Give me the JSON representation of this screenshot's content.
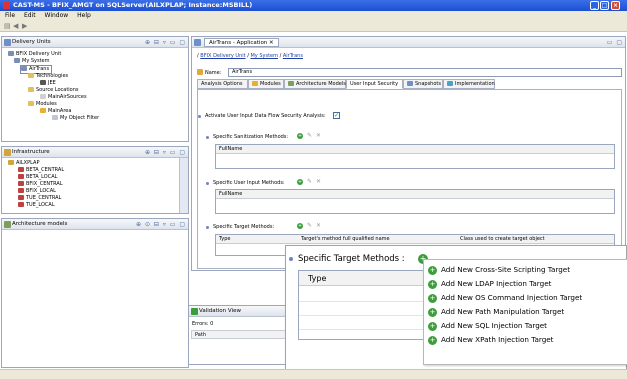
{
  "window": {
    "title": "CAST-MS - BFIX_AMGT on SQLServer(AILXPLAP; Instance:MSBILL)",
    "colors": {
      "titlebar": "#2a5fe0",
      "accent": "#3c9d3c"
    }
  },
  "menubar": [
    "File",
    "Edit",
    "Window",
    "Help"
  ],
  "delivery_units": {
    "title": "Delivery Units",
    "tree": [
      "BFIX Delivery Unit",
      "My System",
      "AirTrans",
      "Technologies",
      "JEE",
      "Source Locations",
      "MainAirSources",
      "Modules",
      "MainArea",
      "My Object Filter"
    ]
  },
  "infrastructure": {
    "title": "Infrastructure",
    "tree": [
      "AILXPLAP",
      "BETA_CENTRAL",
      "BETA_LOCAL",
      "BFIX_CENTRAL",
      "BFIX_LOCAL",
      "TUE_CENTRAL",
      "TUE_LOCAL"
    ]
  },
  "architecture_models": {
    "title": "Architecture models"
  },
  "editor": {
    "tab_title": "AirTrans - Application",
    "breadcrumb": [
      "BFIX Delivery Unit",
      "My System",
      "AirTrans"
    ],
    "name_label": "Name:",
    "name_value": "AirTrans",
    "subtabs": [
      "Analysis Options",
      "Modules",
      "Architecture Models",
      "User Input Security",
      "Snapshots",
      "Implementation"
    ],
    "activate_label": "Activate User Input Data Flow Security Analysis:",
    "sections": [
      {
        "label": "Specific Sanitization Methods:",
        "col": "FullName"
      },
      {
        "label": "Specific User Input Methods:",
        "col": "FullName"
      },
      {
        "label": "Specific Target Methods:",
        "col1": "Type",
        "col2": "Target's method full qualified name",
        "col3": "Class used to create target object"
      }
    ]
  },
  "validation": {
    "title": "Validation View",
    "errors": "Errors: 0",
    "col": "Path"
  },
  "zoom": {
    "label": "Specific Target Methods :",
    "type_col": "Type",
    "menu": [
      "Add New Cross-Site Scripting Target",
      "Add New LDAP Injection Target",
      "Add New OS Command Injection Target",
      "Add New Path Manipulation Target",
      "Add New SQL Injection Target",
      "Add New XPath Injection Target"
    ]
  }
}
